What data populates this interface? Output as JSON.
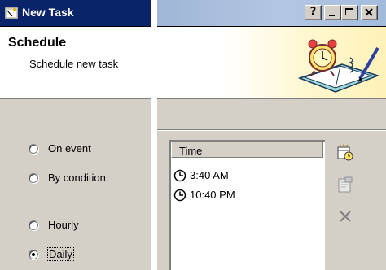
{
  "window": {
    "title": "New Task",
    "caption_buttons": {
      "help": "?",
      "minimize": "_",
      "maximize": "□",
      "close": "✕"
    }
  },
  "header": {
    "title": "Schedule",
    "subtitle": "Schedule new task"
  },
  "trigger_options": [
    {
      "label": "On event",
      "selected": false
    },
    {
      "label": "By condition",
      "selected": false
    },
    {
      "label": "Hourly",
      "selected": false
    },
    {
      "label": "Daily",
      "selected": true
    }
  ],
  "schedule_list": {
    "column_header": "Time",
    "items": [
      "3:40 AM",
      "10:40 PM"
    ]
  },
  "toolbar": {
    "icons": [
      "add-schedule-icon",
      "edit-schedule-icon",
      "delete-schedule-icon"
    ]
  },
  "colors": {
    "titlebar": "#0a246a",
    "dialog_face": "#d4d0c8"
  }
}
